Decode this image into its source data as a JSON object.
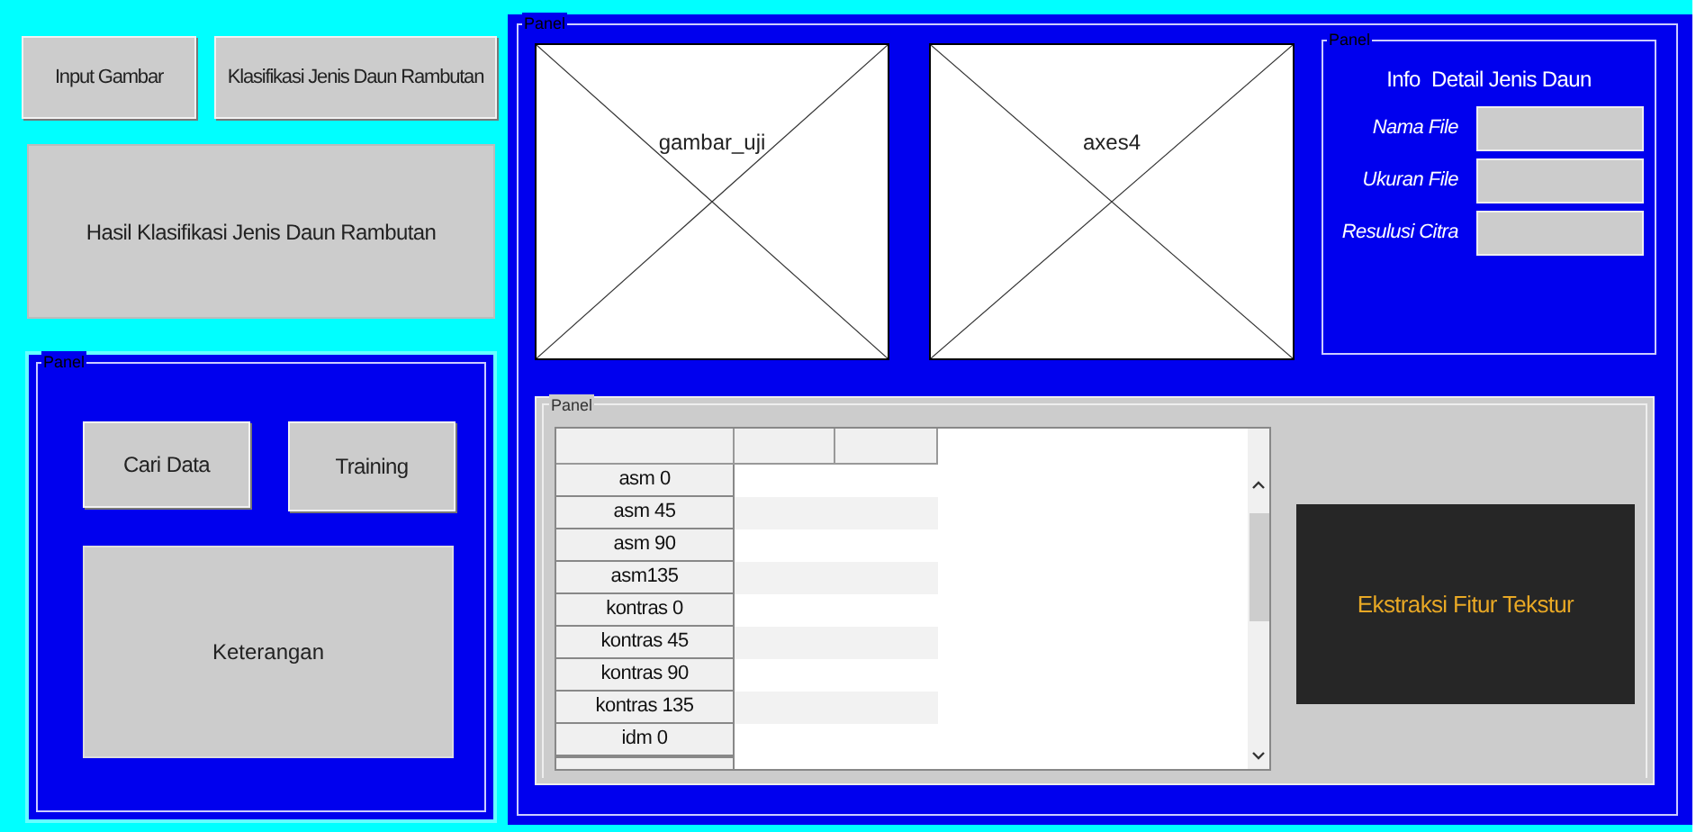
{
  "top_buttons": [
    "Input Gambar",
    "Klasifikasi Jenis Daun Rambutan"
  ],
  "result_box": "Hasil Klasifikasi Jenis Daun Rambutan",
  "left_panel": {
    "title": "Panel",
    "buttons": [
      "Cari Data",
      "Training"
    ],
    "info_box": "Keterangan"
  },
  "main_panel": {
    "title": "Panel",
    "axes": [
      "gambar_uji",
      "axes4"
    ],
    "info_panel": {
      "title": "Panel",
      "heading": "Info  Detail Jenis Daun",
      "fields": [
        {
          "label": "Nama File"
        },
        {
          "label": "Ukuran File"
        },
        {
          "label": "Resulusi Citra"
        }
      ]
    },
    "feature_panel": {
      "title": "Panel",
      "table": {
        "row_headers": [
          "asm 0",
          "asm 45",
          "asm 90",
          "asm135",
          "kontras 0",
          "kontras 45",
          "kontras 90",
          "kontras 135",
          "idm 0"
        ]
      },
      "button": "Ekstraksi Fitur Tekstur"
    }
  }
}
